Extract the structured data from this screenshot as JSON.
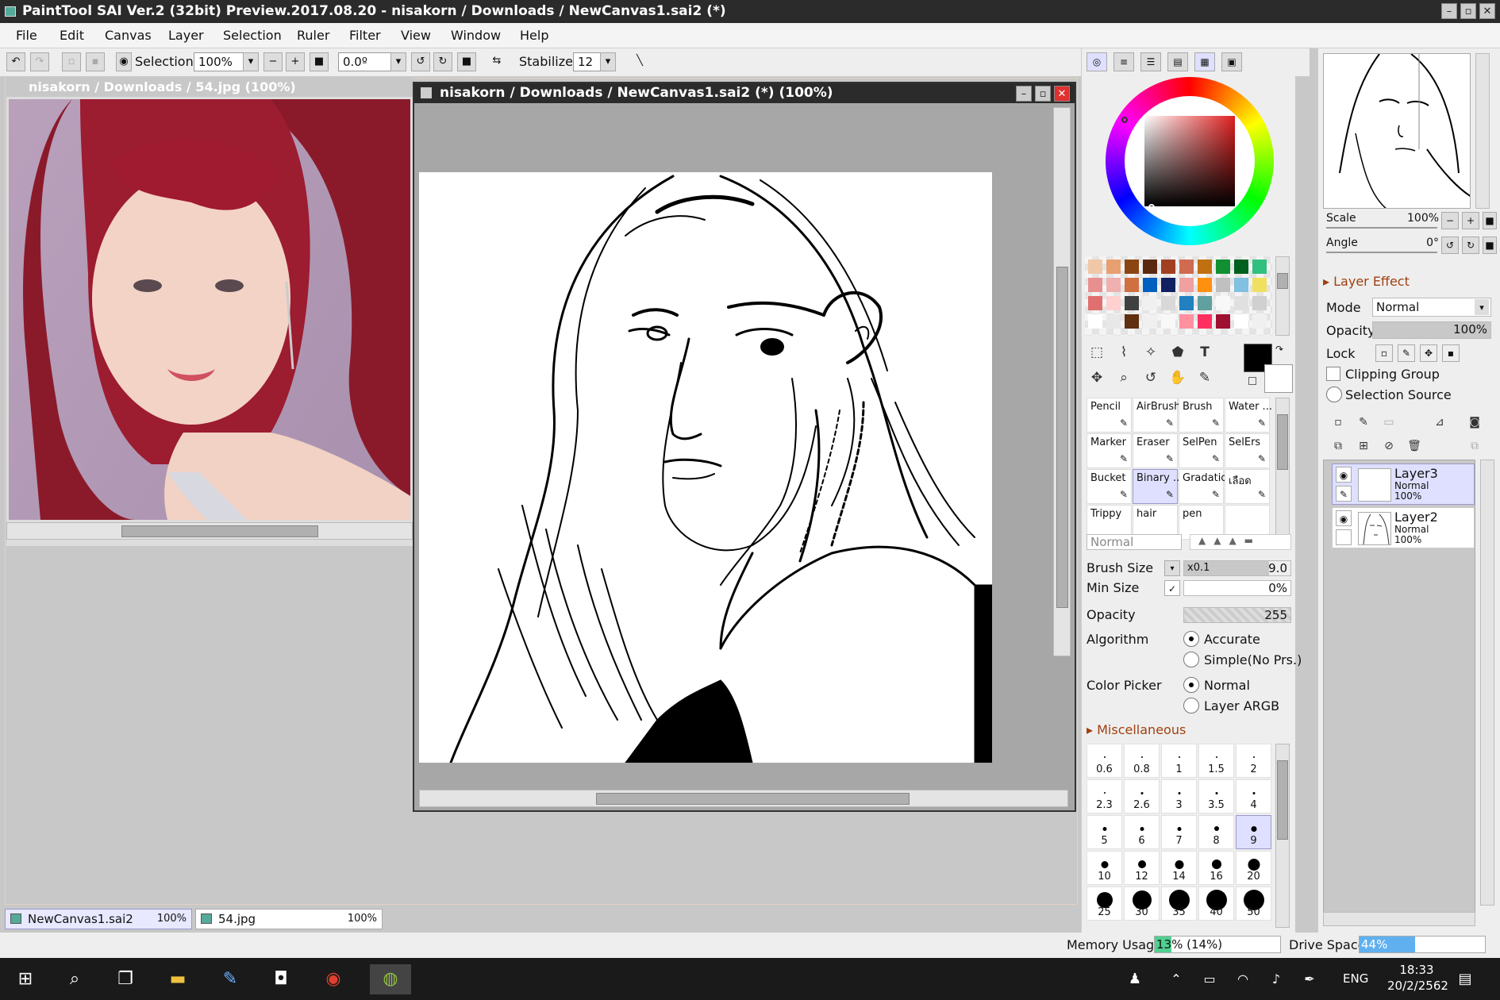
{
  "window": {
    "title": "PaintTool SAI Ver.2 (32bit) Preview.2017.08.20 - nisakorn / Downloads / NewCanvas1.sai2 (*)",
    "minimize": "–",
    "maximize": "▫",
    "close": "✕"
  },
  "menu": [
    "File",
    "Edit",
    "Canvas",
    "Layer",
    "Selection",
    "Ruler",
    "Filter",
    "View",
    "Window",
    "Help"
  ],
  "toolbar": {
    "selection_label": "Selection",
    "zoom": "100%",
    "angle": "0.0º",
    "stabilizer_label": "Stabilizer",
    "stabilizer_value": "12"
  },
  "reference_window": {
    "title": "nisakorn / Downloads / 54.jpg (100%)"
  },
  "canvas_window": {
    "title": "nisakorn / Downloads / NewCanvas1.sai2 (*) (100%)"
  },
  "doc_tabs": [
    {
      "name": "NewCanvas1.sai2",
      "zoom": "100%"
    },
    {
      "name": "54.jpg",
      "zoom": "100%"
    }
  ],
  "swatches": [
    "#f0c8a8",
    "#e8a070",
    "#8b4513",
    "#5a2a10",
    "#a04020",
    "#d06a50",
    "#c07010",
    "#109030",
    "#006020",
    "#30c080",
    "#e89090",
    "#f0b0b0",
    "#d07040",
    "#0060c0",
    "#102060",
    "#f0a0a0",
    "#ff9010",
    "#c0c0c0",
    "#80c0e0",
    "#f0e060",
    "#e07070",
    "#ffd0d0",
    "#404040",
    "#f0f0f0",
    "#d8d8d8",
    "#2080c0",
    "#60a0a0",
    "#f8f8f8",
    "#e0e0e0",
    "#d0d0d0",
    "#ffffff",
    "#e8e8e8",
    "#603010",
    "#f0f0f0",
    "#f8f8f8",
    "#ff90a0",
    "#ff3060",
    "#a01030",
    "#ffffff",
    "#f0f0f0"
  ],
  "brushes": [
    {
      "name": "Pencil"
    },
    {
      "name": "AirBrush"
    },
    {
      "name": "Brush"
    },
    {
      "name": "Water ..."
    },
    {
      "name": "Marker"
    },
    {
      "name": "Eraser"
    },
    {
      "name": "SelPen"
    },
    {
      "name": "SelErs"
    },
    {
      "name": "Bucket"
    },
    {
      "name": "Binary ..."
    },
    {
      "name": "Gradation"
    },
    {
      "name": "เลือด"
    },
    {
      "name": "Trippy"
    },
    {
      "name": "hair"
    },
    {
      "name": "pen"
    },
    {
      "name": ""
    }
  ],
  "brush_settings": {
    "blend_mode": "Normal",
    "brush_size_label": "Brush Size",
    "brush_size_mult": "x0.1",
    "brush_size_value": "9.0",
    "min_size_label": "Min Size",
    "min_size_value": "0%",
    "opacity_label": "Opacity",
    "opacity_value": "255",
    "algorithm_label": "Algorithm",
    "algo_accurate": "Accurate",
    "algo_simple": "Simple(No Prs.)",
    "color_picker_label": "Color Picker",
    "cp_normal": "Normal",
    "cp_layer": "Layer ARGB",
    "misc_label": "Miscellaneous"
  },
  "brush_sizes": [
    "0.6",
    "0.8",
    "1",
    "1.5",
    "2",
    "2.3",
    "2.6",
    "3",
    "3.5",
    "4",
    "5",
    "6",
    "7",
    "8",
    "9",
    "10",
    "12",
    "14",
    "16",
    "20",
    "25",
    "30",
    "35",
    "40",
    "50"
  ],
  "navigator": {
    "scale_label": "Scale",
    "scale_value": "100%",
    "angle_label": "Angle",
    "angle_value": "0°"
  },
  "layer_props": {
    "effect_label": "Layer Effect",
    "mode_label": "Mode",
    "mode_value": "Normal",
    "opacity_label": "Opacity",
    "opacity_value": "100%",
    "lock_label": "Lock",
    "clipping_label": "Clipping Group",
    "selection_source_label": "Selection Source"
  },
  "layers": [
    {
      "name": "Layer3",
      "mode": "Normal",
      "opacity": "100%"
    },
    {
      "name": "Layer2",
      "mode": "Normal",
      "opacity": "100%"
    }
  ],
  "status": {
    "memory_label": "Memory Usage",
    "memory_value": "13% (14%)",
    "memory_fraction": 0.13,
    "drive_label": "Drive Space",
    "drive_value": "44%",
    "drive_fraction": 0.44
  },
  "taskbar": {
    "lang": "ENG",
    "time": "18:33",
    "date": "20/2/2562"
  },
  "colors": {
    "accent_tab": "#dfe0ff",
    "misc_header": "#a04010",
    "memory_bar": "#50d090",
    "drive_bar": "#60b0f0"
  }
}
